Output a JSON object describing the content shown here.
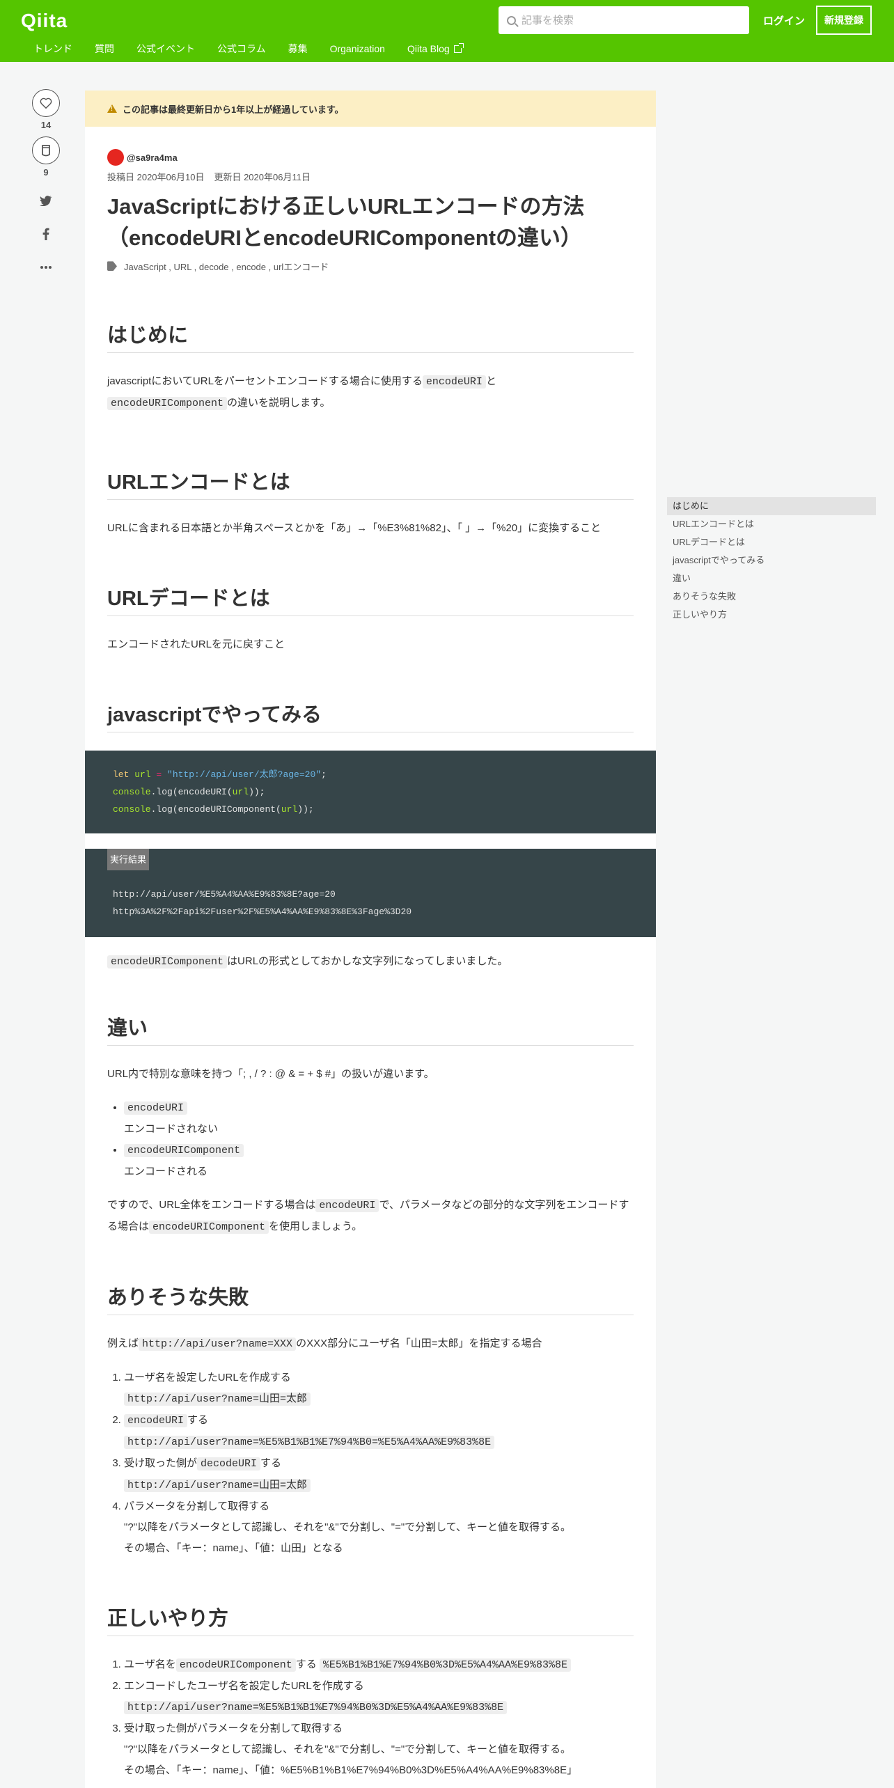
{
  "header": {
    "logo": "Qiita",
    "search_placeholder": "記事を検索",
    "login": "ログイン",
    "signup": "新規登録",
    "nav": [
      "トレンド",
      "質問",
      "公式イベント",
      "公式コラム",
      "募集",
      "Organization",
      "Qiita Blog"
    ]
  },
  "side": {
    "like_count": "14",
    "stock_count": "9"
  },
  "alert": "この記事は最終更新日から1年以上が経過しています。",
  "meta": {
    "author": "@sa9ra4ma",
    "posted": "投稿日 2020年06月10日",
    "updated": "更新日 2020年06月11日"
  },
  "title": "JavaScriptにおける正しいURLエンコードの方法（encodeURIとencodeURIComponentの違い）",
  "tags": "JavaScript , URL , decode , encode , urlエンコード",
  "sections": {
    "intro": {
      "heading": "はじめに",
      "p1": "javascriptにおいてURLをパーセントエンコードする場合に使用する",
      "code1": "encodeURI",
      "p2": "と",
      "code2": "encodeURIComponent",
      "p3": "の違いを説明します。"
    },
    "urlencode": {
      "heading": "URLエンコードとは",
      "p": "URLに含まれる日本語とか半角スペースとかを「あ」→「%E3%81%82」、「 」→「%20」に変換すること"
    },
    "urldecode": {
      "heading": "URLデコードとは",
      "p": "エンコードされたURLを元に戻すこと"
    },
    "tryjs": {
      "heading": "javascriptでやってみる",
      "code_kw": "let",
      "code_var": "url",
      "code_eq": " = ",
      "code_str": "\"http://api/user/太郎?age=20\"",
      "code_semi": ";",
      "code_console": "console",
      "code_log": ".log",
      "code_line2a": "(encodeURI(",
      "code_line2b": "));",
      "code_line3a": "(encodeURIComponent(",
      "code_line3b": "));",
      "result_label": "実行結果",
      "result1": "http://api/user/%E5%A4%AA%E9%83%8E?age=20",
      "result2": "http%3A%2F%2Fapi%2Fuser%2F%E5%A4%AA%E9%83%8E%3Fage%3D20",
      "after_code": "encodeURIComponent",
      "after_text": "はURLの形式としておかしな文字列になってしまいました。"
    },
    "diff": {
      "heading": "違い",
      "p": "URL内で特別な意味を持つ「; , / ? : @ & = + $ #」の扱いが違います。",
      "item1_code": "encodeURI",
      "item1_text": "エンコードされない",
      "item2_code": "encodeURIComponent",
      "item2_text": "エンコードされる",
      "c1": "ですので、URL全体をエンコードする場合は",
      "c_code1": "encodeURI",
      "c2": "で、パラメータなどの部分的な文字列をエンコードする場合は",
      "c_code2": "encodeURIComponent",
      "c3": "を使用しましょう。"
    },
    "fail": {
      "heading": "ありそうな失敗",
      "p1": "例えば",
      "p_code": "http://api/user?name=XXX",
      "p2": "のXXX部分にユーザ名「山田=太郎」を指定する場合",
      "s1": "ユーザ名を設定したURLを作成する",
      "s1_code": "http://api/user?name=山田=太郎",
      "s2_code": "encodeURI",
      "s2": "する",
      "s2_res": "http://api/user?name=%E5%B1%B1%E7%94%B0=%E5%A4%AA%E9%83%8E",
      "s3": "受け取った側が",
      "s3_code": "decodeURI",
      "s3b": "する",
      "s3_res": "http://api/user?name=山田=太郎",
      "s4": "パラメータを分割して取得する",
      "s4_l1": "\"?\"以降をパラメータとして認識し、それを\"&\"で分割し、\"=\"で分割して、キーと値を取得する。",
      "s4_l2": "その場合、「キー：name」、「値：山田」となる"
    },
    "right": {
      "heading": "正しいやり方",
      "s1": "ユーザ名を",
      "s1_code": "encodeURIComponent",
      "s1b": "する",
      "s1_res": "%E5%B1%B1%E7%94%B0%3D%E5%A4%AA%E9%83%8E",
      "s2": "エンコードしたユーザ名を設定したURLを作成する",
      "s2_res": "http://api/user?name=%E5%B1%B1%E7%94%B0%3D%E5%A4%AA%E9%83%8E",
      "s3": "受け取った側がパラメータを分割して取得する",
      "s3_l1": "\"?\"以降をパラメータとして認識し、それを\"&\"で分割し、\"=\"で分割して、キーと値を取得する。",
      "s3_l2": "その場合、「キー：name」、「値：%E5%B1%B1%E7%94%B0%3D%E5%A4%AA%E9%83%8E」"
    }
  },
  "toc": [
    "はじめに",
    "URLエンコードとは",
    "URLデコードとは",
    "javascriptでやってみる",
    "違い",
    "ありそうな失敗",
    "正しいやり方"
  ]
}
